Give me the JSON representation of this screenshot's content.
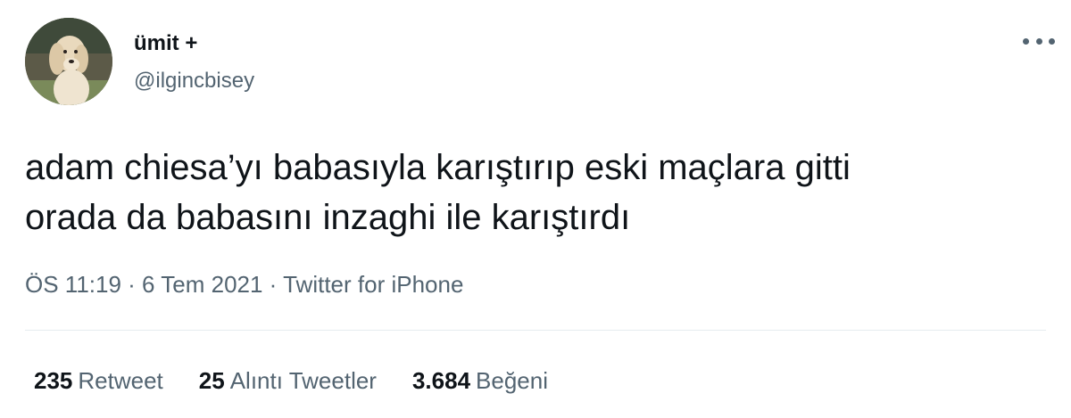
{
  "user": {
    "display_name": "ümit +",
    "handle": "@ilgincbisey"
  },
  "tweet": {
    "lines": [
      "adam chiesa’yı babasıyla karıştırıp eski maçlara gitti",
      "orada da babasını inzaghi ile karıştırdı"
    ],
    "time": "ÖS 11:19",
    "separator": " · ",
    "date": "6 Tem 2021",
    "source": "Twitter for iPhone"
  },
  "stats": {
    "retweets": {
      "count": "235",
      "label": "Retweet"
    },
    "quotes": {
      "count": "25",
      "label": "Alıntı Tweetler"
    },
    "likes": {
      "count": "3.684",
      "label": "Beğeni"
    }
  },
  "icons": {
    "more": "more-horizontal-icon",
    "avatar": "dog-avatar"
  },
  "colors": {
    "text": "#0f1419",
    "secondary": "#536471",
    "divider": "#e6ecf0"
  }
}
